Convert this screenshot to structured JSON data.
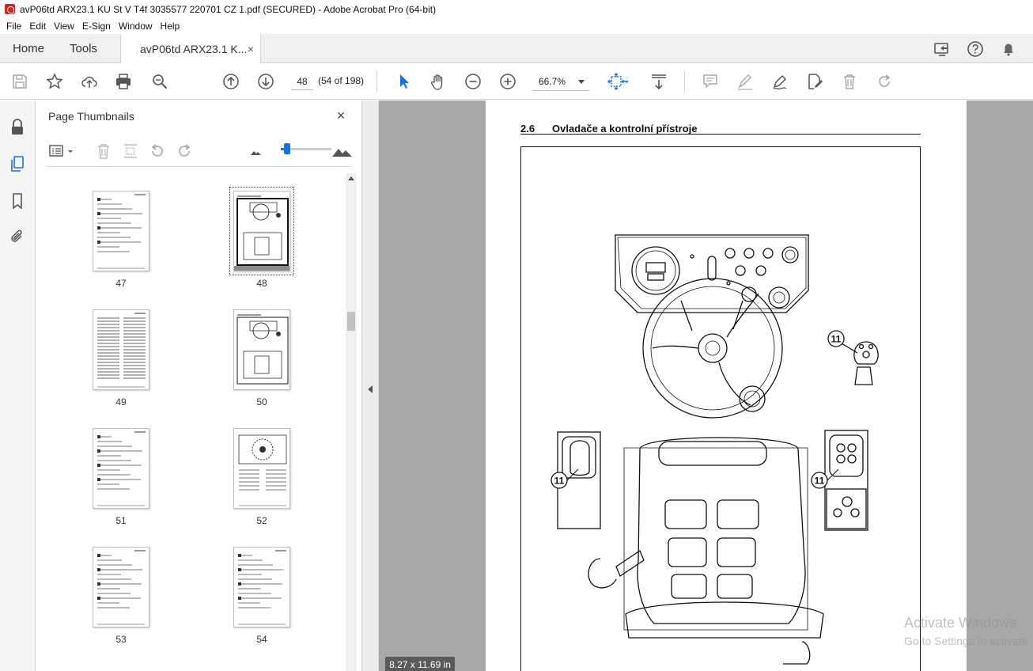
{
  "window": {
    "title": "avP06td ARX23.1 KU St V T4f 3035577 220701 CZ 1.pdf (SECURED) - Adobe Acrobat Pro (64-bit)"
  },
  "menu": [
    "File",
    "Edit",
    "View",
    "E-Sign",
    "Window",
    "Help"
  ],
  "tabs": {
    "home": "Home",
    "tools": "Tools",
    "document": "avP06td ARX23.1 K...",
    "document_close": "×"
  },
  "toolbar": {
    "page_number": "48",
    "page_count": "(54 of 198)",
    "zoom": "66.7%"
  },
  "thumbnails_panel": {
    "title": "Page Thumbnails",
    "close": "×",
    "size_slider_fraction": 0.1,
    "pages": [
      {
        "label": "47",
        "selected": false,
        "kind": "text"
      },
      {
        "label": "48",
        "selected": true,
        "kind": "figure"
      },
      {
        "label": "49",
        "selected": false,
        "kind": "dense-text"
      },
      {
        "label": "50",
        "selected": false,
        "kind": "figure"
      },
      {
        "label": "51",
        "selected": false,
        "kind": "text"
      },
      {
        "label": "52",
        "selected": false,
        "kind": "gauge"
      },
      {
        "label": "53",
        "selected": false,
        "kind": "text"
      },
      {
        "label": "54",
        "selected": false,
        "kind": "text"
      }
    ]
  },
  "document": {
    "section_number": "2.6",
    "section_title": "Ovladače a kontrolní přístroje",
    "callout_label": "11",
    "page_size": "8.27 x 11.69 in"
  },
  "watermark": {
    "line1": "Activate Windows",
    "line2": "Go to Settings to activate"
  },
  "colors": {
    "accent": "#1473e6",
    "acrobat_red": "#d7251d"
  }
}
